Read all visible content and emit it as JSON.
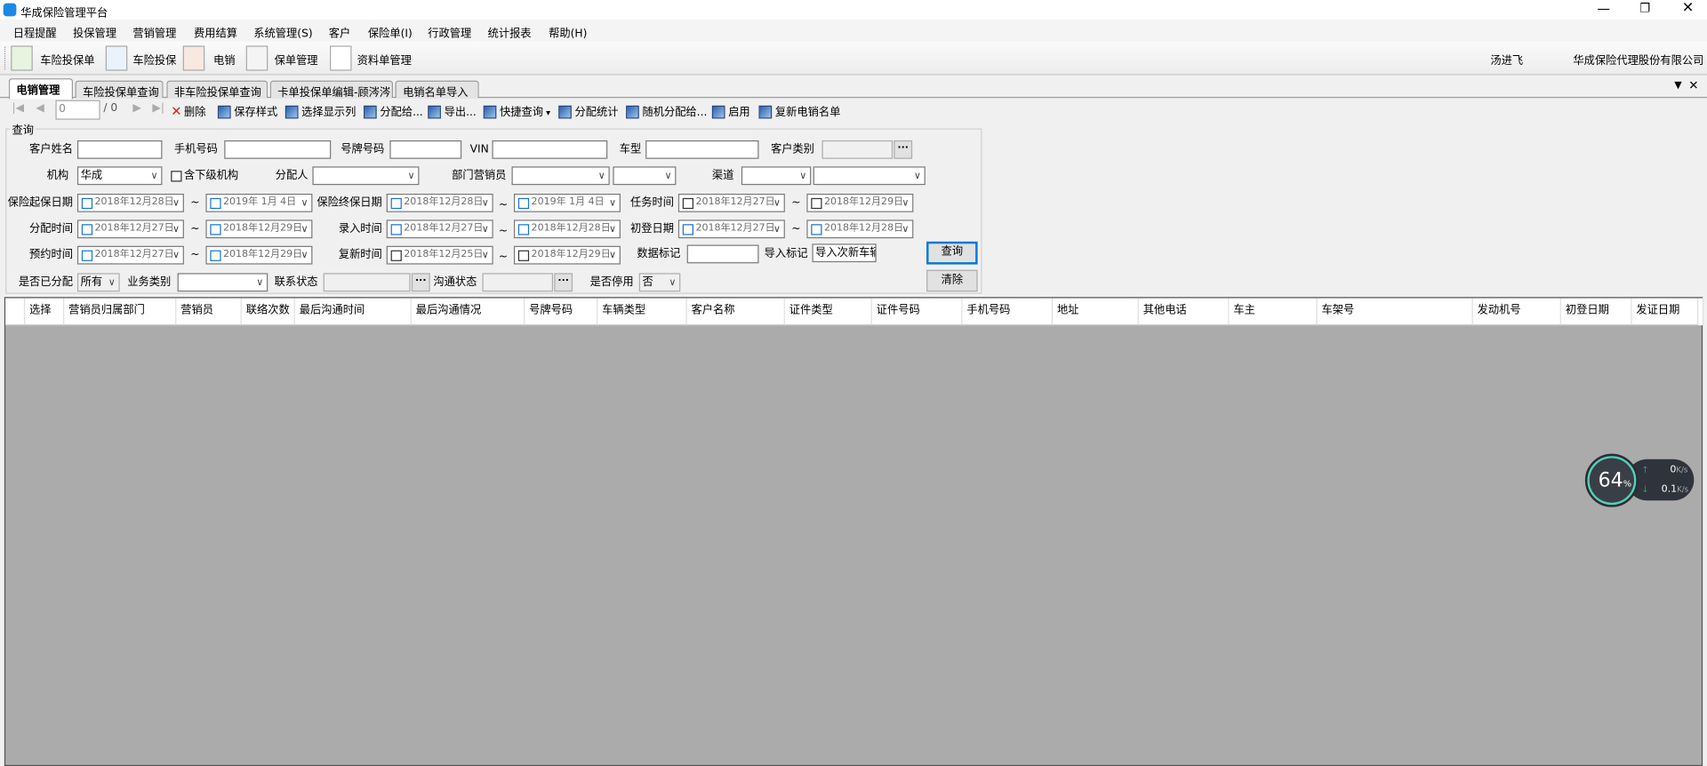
{
  "window": {
    "title": "华成保险管理平台"
  },
  "menu": [
    "日程提醒",
    "投保管理",
    "营销管理",
    "费用结算",
    "系统管理(S)",
    "客户",
    "保险单(I)",
    "行政管理",
    "统计报表",
    "帮助(H)"
  ],
  "toolbar": {
    "items": [
      "车险投保单",
      "车险投保",
      "电销",
      "保单管理",
      "资料单管理"
    ],
    "user": "汤进飞",
    "company": "华成保险代理股份有限公司"
  },
  "tabs": [
    "电销管理",
    "车险投保单查询",
    "非车险投保单查询",
    "卡单投保单编辑-顾涔涔",
    "电销名单导入"
  ],
  "actions": {
    "page": "0",
    "total": "/ 0",
    "items": [
      "删除",
      "保存样式",
      "选择显示列",
      "分配给...",
      "导出...",
      "快捷查询",
      "分配统计",
      "随机分配给...",
      "启用",
      "复新电销名单"
    ]
  },
  "query": {
    "group": "查询",
    "labels": {
      "name": "客户姓名",
      "mobile": "手机号码",
      "plate": "号牌号码",
      "vin": "VIN",
      "model": "车型",
      "ctype": "客户类别",
      "org": "机构",
      "sub": "含下级机构",
      "assignee": "分配人",
      "deptsales": "部门营销员",
      "channel": "渠道",
      "start": "保险起保日期",
      "end": "保险终保日期",
      "task": "任务时间",
      "assign": "分配时间",
      "entry": "录入时间",
      "reg": "初登日期",
      "appt": "预约时间",
      "renew": "复新时间",
      "mark": "数据标记",
      "importmark": "导入标记",
      "assigned": "是否已分配",
      "biz": "业务类别",
      "contact": "联系状态",
      "comm": "沟通状态",
      "disabled": "是否停用"
    },
    "values": {
      "org": "华成",
      "importmark": "导入次新车辆",
      "assigned": "所有",
      "disabled": "否",
      "tilde": "~",
      "dots": "···",
      "start_from": "2018年12月28日",
      "start_to": "2019年 1月 4日",
      "end_from": "2018年12月28日",
      "end_to": "2019年 1月 4日",
      "task_from": "2018年12月27日",
      "task_to": "2018年12月29日",
      "assign_from": "2018年12月27日",
      "assign_to": "2018年12月29日",
      "entry_from": "2018年12月27日",
      "entry_to": "2018年12月28日",
      "reg_from": "2018年12月27日",
      "reg_to": "2018年12月28日",
      "appt_from": "2018年12月27日",
      "appt_to": "2018年12月29日",
      "renew_from": "2018年12月25日",
      "renew_to": "2018年12月29日"
    },
    "buttons": {
      "search": "查询",
      "clear": "清除"
    }
  },
  "grid": {
    "columns": [
      "选择",
      "营销员归属部门",
      "营销员",
      "联络次数",
      "最后沟通时间",
      "最后沟通情况",
      "号牌号码",
      "车辆类型",
      "客户名称",
      "证件类型",
      "证件号码",
      "手机号码",
      "地址",
      "其他电话",
      "车主",
      "车架号",
      "发动机号",
      "初登日期",
      "发证日期"
    ]
  },
  "netmonitor": {
    "percent": "64",
    "unit": "%",
    "up": "0",
    "down": "0.1",
    "rate_unit": "K/s",
    "colors": {
      "up": "#3ba7e6",
      "down": "#3cc23c"
    }
  }
}
